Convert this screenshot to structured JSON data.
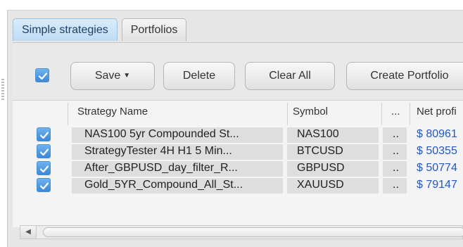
{
  "tabs": [
    {
      "label": "Simple strategies",
      "active": true
    },
    {
      "label": "Portfolios",
      "active": false
    }
  ],
  "toolbar": {
    "select_all_checked": true,
    "save_label": "Save",
    "delete_label": "Delete",
    "clear_all_label": "Clear All",
    "create_portfolio_label": "Create Portfolio"
  },
  "table": {
    "columns": {
      "strategy_name": "Strategy Name",
      "symbol": "Symbol",
      "more": "...",
      "net_profit": "Net profi"
    },
    "rows": [
      {
        "checked": true,
        "name": "NAS100 5yr Compounded St...",
        "symbol": "NAS100",
        "more": "..",
        "net_profit": "$ 80961"
      },
      {
        "checked": true,
        "name": "StrategyTester 4H H1 5 Min...",
        "symbol": "BTCUSD",
        "more": "..",
        "net_profit": "$ 50355"
      },
      {
        "checked": true,
        "name": "After_GBPUSD_day_filter_R...",
        "symbol": "GBPUSD",
        "more": "..",
        "net_profit": "$ 50774"
      },
      {
        "checked": true,
        "name": "Gold_5YR_Compound_All_St...",
        "symbol": "XAUUSD",
        "more": "..",
        "net_profit": "$ 79147"
      }
    ]
  },
  "colors": {
    "accent": "#3c88d8",
    "profit": "#2457c5"
  }
}
